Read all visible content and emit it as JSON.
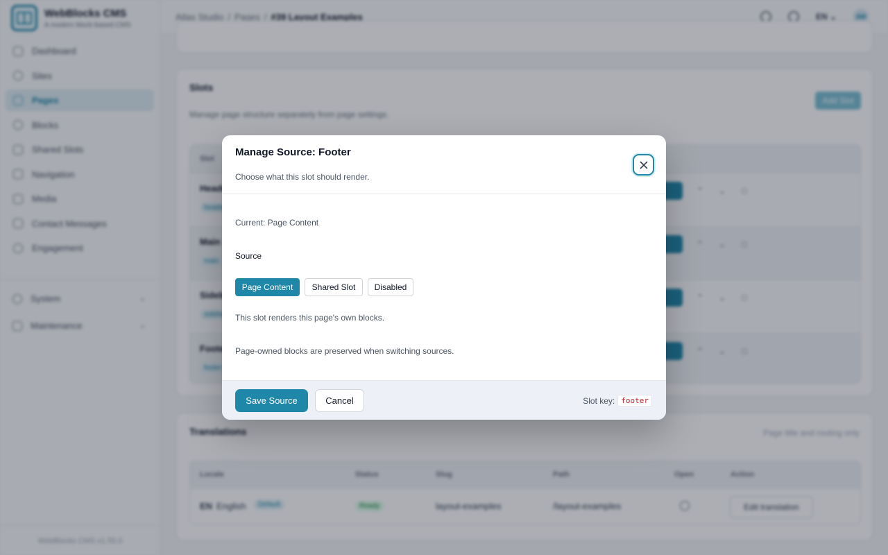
{
  "brand": {
    "title": "WebBlocks CMS",
    "subtitle": "A modern block-based CMS"
  },
  "sidebar": {
    "items": [
      {
        "label": "Dashboard",
        "icon": "dashboard-icon"
      },
      {
        "label": "Sites",
        "icon": "globe-icon"
      },
      {
        "label": "Pages",
        "icon": "page-icon",
        "active": true
      },
      {
        "label": "Blocks",
        "icon": "blocks-icon"
      },
      {
        "label": "Shared Slots",
        "icon": "shared-slots-icon"
      },
      {
        "label": "Navigation",
        "icon": "navigation-icon"
      },
      {
        "label": "Media",
        "icon": "media-icon"
      },
      {
        "label": "Contact Messages",
        "icon": "mail-icon"
      },
      {
        "label": "Engagement",
        "icon": "star-icon"
      }
    ],
    "groups": [
      {
        "label": "System",
        "icon": "gear-icon"
      },
      {
        "label": "Maintenance",
        "icon": "file-icon"
      }
    ],
    "version": "WebBlocks CMS v1.55.0"
  },
  "header": {
    "breadcrumb": [
      "Atlas Studio",
      "Pages",
      "#39 Layout Examples"
    ],
    "language": "EN",
    "avatar": "AW"
  },
  "slots_card": {
    "title": "Slots",
    "description": "Manage page structure separately from page settings.",
    "add_label": "Add Slot",
    "column_header": "Slot",
    "rows": [
      {
        "name": "Header",
        "tag": "header"
      },
      {
        "name": "Main",
        "tag": "main"
      },
      {
        "name": "Sidebar",
        "tag": "sidebar"
      },
      {
        "name": "Footer",
        "tag": "footer"
      }
    ]
  },
  "translations": {
    "title": "Translations",
    "note": "Page title and routing only",
    "columns": [
      "Locale",
      "Status",
      "Slug",
      "Path",
      "Open",
      "Action"
    ],
    "row": {
      "code": "EN",
      "language": "English",
      "default_badge": "Default",
      "status": "Ready",
      "slug": "layout-examples",
      "path": "/layout-examples",
      "action": "Edit translation"
    }
  },
  "modal": {
    "title": "Manage Source: Footer",
    "subtitle": "Choose what this slot should render.",
    "current": "Current: Page Content",
    "source_label": "Source",
    "options": [
      "Page Content",
      "Shared Slot",
      "Disabled"
    ],
    "selected": "Page Content",
    "help": "This slot renders this page's own blocks.",
    "note": "Page-owned blocks are preserved when switching sources.",
    "save_label": "Save Source",
    "cancel_label": "Cancel",
    "slot_key_label": "Slot key:",
    "slot_key_value": "footer"
  },
  "colors": {
    "accent": "#1f87a8",
    "danger_code": "#c0262d"
  }
}
